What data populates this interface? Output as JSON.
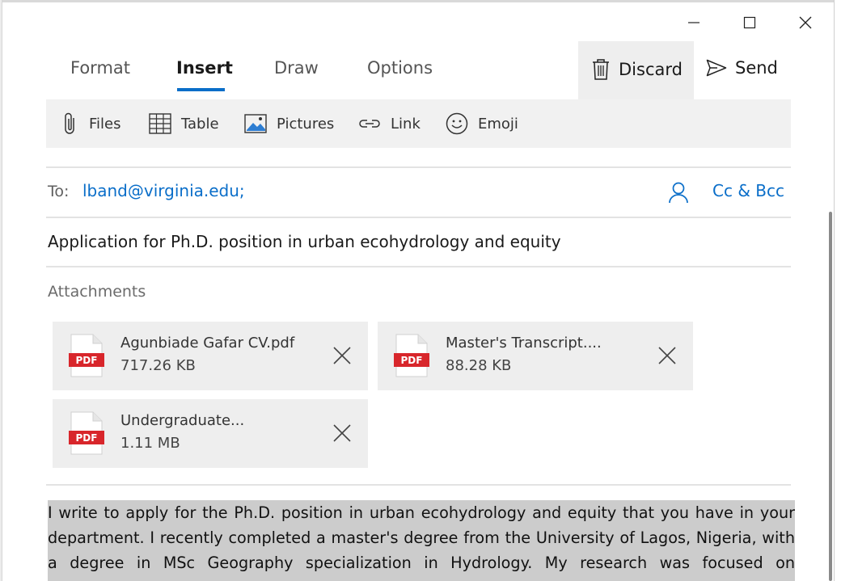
{
  "window_controls": {
    "minimize": "minimize",
    "maximize": "maximize",
    "close": "close"
  },
  "tabs": [
    {
      "label": "Format",
      "active": false
    },
    {
      "label": "Insert",
      "active": true
    },
    {
      "label": "Draw",
      "active": false
    },
    {
      "label": "Options",
      "active": false
    }
  ],
  "actions": {
    "discard_label": "Discard",
    "send_label": "Send"
  },
  "ribbon": {
    "files": "Files",
    "table": "Table",
    "pictures": "Pictures",
    "link": "Link",
    "emoji": "Emoji"
  },
  "to": {
    "label": "To:",
    "value": "lband@virginia.edu;",
    "cc_bcc": "Cc & Bcc"
  },
  "subject": "Application for Ph.D. position in urban ecohydrology and equity",
  "attachments": {
    "title": "Attachments",
    "items": [
      {
        "name": "Agunbiade Gafar CV.pdf",
        "size": "717.26 KB",
        "type": "PDF"
      },
      {
        "name": "Master's Transcript....",
        "size": "88.28 KB",
        "type": "PDF"
      },
      {
        "name": "Undergraduate...",
        "size": "1.11 MB",
        "type": "PDF"
      }
    ]
  },
  "body": {
    "lines": [
      "I write to apply for the Ph.D. position in urban ecohydrology and equity that you have in your",
      "department. I recently completed a master's degree from the University of Lagos, Nigeria, with",
      "a degree in MSc Geography specialization in Hydrology. My research was focused on"
    ]
  },
  "colors": {
    "accent": "#0a6ec9",
    "pdf_red": "#d8262b",
    "selection": "#cccccc"
  }
}
